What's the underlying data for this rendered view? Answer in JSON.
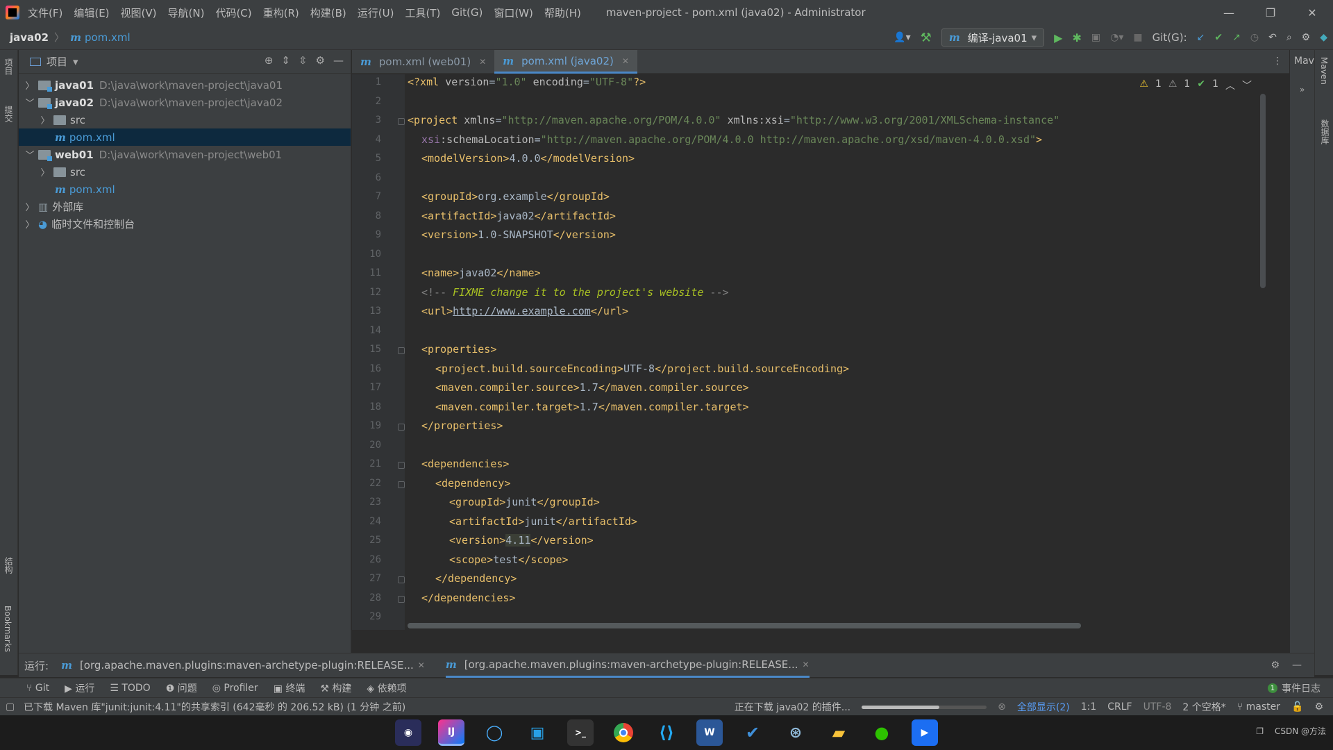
{
  "titlebar": {
    "menus": [
      "文件(F)",
      "编辑(E)",
      "视图(V)",
      "导航(N)",
      "代码(C)",
      "重构(R)",
      "构建(B)",
      "运行(U)",
      "工具(T)",
      "Git(G)",
      "窗口(W)",
      "帮助(H)"
    ],
    "window_title": "maven-project - pom.xml (java02) - Administrator"
  },
  "navbar": {
    "breadcrumb": [
      "java02",
      "pom.xml"
    ],
    "run_config": "编译-java01",
    "git_label": "Git(G):"
  },
  "left_strip": {
    "project": "项目",
    "commit": "提交",
    "structure": "结构",
    "bookmarks": "Bookmarks"
  },
  "right_strip": {
    "maven": "Maven",
    "database": "数据库"
  },
  "maven_panel_label": "Mav",
  "project_panel": {
    "title": "项目",
    "tree": [
      {
        "name": "java01",
        "path": "D:\\java\\work\\maven-project\\java01"
      },
      {
        "name": "java02",
        "path": "D:\\java\\work\\maven-project\\java02"
      },
      {
        "name": "src"
      },
      {
        "name": "pom.xml"
      },
      {
        "name": "web01",
        "path": "D:\\java\\work\\maven-project\\web01"
      },
      {
        "name": "src"
      },
      {
        "name": "pom.xml"
      },
      {
        "name": "外部库"
      },
      {
        "name": "临时文件和控制台"
      }
    ]
  },
  "tabs": [
    {
      "label": "pom.xml (web01)"
    },
    {
      "label": "pom.xml (java02)"
    }
  ],
  "inspections": {
    "warnings": "1",
    "weak_warnings": "1",
    "ok": "1"
  },
  "editor": {
    "lines": [
      "1",
      "2",
      "3",
      "4",
      "5",
      "6",
      "7",
      "8",
      "9",
      "10",
      "11",
      "12",
      "13",
      "14",
      "15",
      "16",
      "17",
      "18",
      "19",
      "20",
      "21",
      "22",
      "23",
      "24",
      "25",
      "26",
      "27",
      "28",
      "29"
    ],
    "code": {
      "l1": {
        "a": "<?xml ",
        "b": "version",
        "c": "=",
        "d": "\"1.0\"",
        "e": " ",
        "f": "encoding",
        "g": "=",
        "h": "\"UTF-8\"",
        "i": "?>"
      },
      "l3": {
        "a": "<project ",
        "b": "xmlns",
        "c": "=",
        "d": "\"http://maven.apache.org/POM/4.0.0\"",
        "e": " ",
        "f": "xmlns:xsi",
        "g": "=",
        "h": "\"http://www.w3.org/2001/XMLSchema-instance\""
      },
      "l4": {
        "a": "xsi",
        "b": ":schemaLocation",
        "c": "=",
        "d": "\"http://maven.apache.org/POM/4.0.0 http://maven.apache.org/xsd/maven-4.0.0.xsd\"",
        "e": ">"
      },
      "l5": {
        "a": "<modelVersion>",
        "b": "4.0.0",
        "c": "</modelVersion>"
      },
      "l7": {
        "a": "<groupId>",
        "b": "org.example",
        "c": "</groupId>"
      },
      "l8": {
        "a": "<artifactId>",
        "b": "java02",
        "c": "</artifactId>"
      },
      "l9": {
        "a": "<version>",
        "b": "1.0-SNAPSHOT",
        "c": "</version>"
      },
      "l11": {
        "a": "<name>",
        "b": "java02",
        "c": "</name>"
      },
      "l12": {
        "a": "<!-- ",
        "b": "FIXME change it to the project's website",
        "c": " -->"
      },
      "l13": {
        "a": "<url>",
        "b": "http://www.example.com",
        "c": "</url>"
      },
      "l15": {
        "a": "<properties>"
      },
      "l16": {
        "a": "<project.build.sourceEncoding>",
        "b": "UTF-8",
        "c": "</project.build.sourceEncoding>"
      },
      "l17": {
        "a": "<maven.compiler.source>",
        "b": "1.7",
        "c": "</maven.compiler.source>"
      },
      "l18": {
        "a": "<maven.compiler.target>",
        "b": "1.7",
        "c": "</maven.compiler.target>"
      },
      "l19": {
        "a": "</properties>"
      },
      "l21": {
        "a": "<dependencies>"
      },
      "l22": {
        "a": "<dependency>"
      },
      "l23": {
        "a": "<groupId>",
        "b": "junit",
        "c": "</groupId>"
      },
      "l24": {
        "a": "<artifactId>",
        "b": "junit",
        "c": "</artifactId>"
      },
      "l25": {
        "a": "<version>",
        "b": "4.11",
        "c": "</version>"
      },
      "l26": {
        "a": "<scope>",
        "b": "test",
        "c": "</scope>"
      },
      "l27": {
        "a": "</dependency>"
      },
      "l28": {
        "a": "</dependencies>"
      }
    }
  },
  "run_bar": {
    "label": "运行:",
    "tabs": [
      "[org.apache.maven.plugins:maven-archetype-plugin:RELEASE...",
      "[org.apache.maven.plugins:maven-archetype-plugin:RELEASE..."
    ]
  },
  "tool_windows": [
    "Git",
    "运行",
    "TODO",
    "问题",
    "Profiler",
    "终端",
    "构建",
    "依赖项"
  ],
  "event_log": {
    "count": "1",
    "label": "事件日志"
  },
  "status": {
    "message": "已下载 Maven 库\"junit:junit:4.11\"的共享索引 (642毫秒 的 206.52 kB) (1 分钟 之前)",
    "task": "正在下载 java02 的插件...",
    "progress": 0.62,
    "show_all": "全部显示(2)",
    "position": "1:1",
    "line_sep": "CRLF",
    "encoding": "UTF-8",
    "indent": "2 个空格*",
    "branch": "master"
  },
  "taskbar": {
    "watermark": "CSDN @方法"
  },
  "colors": {
    "accent": "#4a88c7",
    "tag": "#e8bf6a",
    "attr_value": "#6a8759",
    "comment": "#629755",
    "bg": "#2b2b2b",
    "panel": "#3c3f41"
  }
}
